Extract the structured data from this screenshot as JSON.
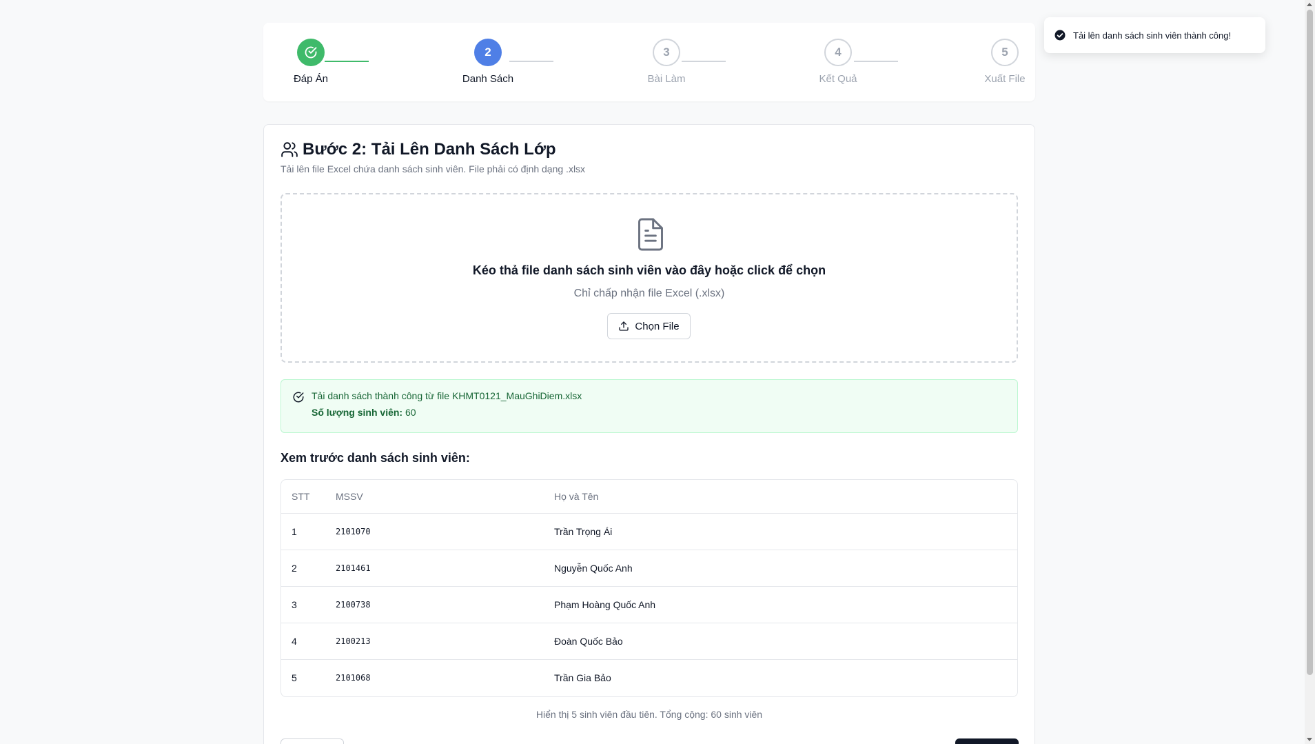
{
  "stepper": {
    "steps": [
      {
        "number": "",
        "label": "Đáp Án",
        "state": "done"
      },
      {
        "number": "2",
        "label": "Danh Sách",
        "state": "active"
      },
      {
        "number": "3",
        "label": "Bài Làm",
        "state": "pending"
      },
      {
        "number": "4",
        "label": "Kết Quả",
        "state": "pending"
      },
      {
        "number": "5",
        "label": "Xuất File",
        "state": "pending"
      }
    ]
  },
  "toast": {
    "message": "Tải lên danh sách sinh viên thành công!",
    "icon": "check-circle-icon"
  },
  "main": {
    "title": "Bước 2: Tải Lên Danh Sách Lớp",
    "title_icon": "users-icon",
    "subtitle": "Tải lên file Excel chứa danh sách sinh viên. File phải có định dạng .xlsx",
    "dropzone": {
      "icon": "file-text-icon",
      "title": "Kéo thả file danh sách sinh viên vào đây hoặc click để chọn",
      "subtitle": "Chỉ chấp nhận file Excel (.xlsx)",
      "button_label": "Chọn File"
    },
    "success": {
      "message": "Tải danh sách thành công từ file KHMT0121_MauGhiDiem.xlsx",
      "count_label": "Số lượng sinh viên:",
      "count_value": "60"
    },
    "preview_title": "Xem trước danh sách sinh viên:",
    "table": {
      "headers": {
        "stt": "STT",
        "mssv": "MSSV",
        "name": "Họ và Tên"
      },
      "rows": [
        {
          "stt": "1",
          "mssv": "2101070",
          "name": "Trần Trọng Ái"
        },
        {
          "stt": "2",
          "mssv": "2101461",
          "name": "Nguyễn Quốc Anh"
        },
        {
          "stt": "3",
          "mssv": "2100738",
          "name": "Phạm Hoàng Quốc Anh"
        },
        {
          "stt": "4",
          "mssv": "2100213",
          "name": "Đoàn Quốc Bảo"
        },
        {
          "stt": "5",
          "mssv": "2101068",
          "name": "Trần Gia Bảo"
        }
      ]
    },
    "footer_note": "Hiển thị 5 sinh viên đầu tiên. Tổng cộng: 60 sinh viên"
  },
  "colors": {
    "done": "#3fba6a",
    "active": "#4f7fe6",
    "pending": "#d1d5db",
    "success_bg": "#f0fdf4",
    "success_text": "#166534"
  }
}
